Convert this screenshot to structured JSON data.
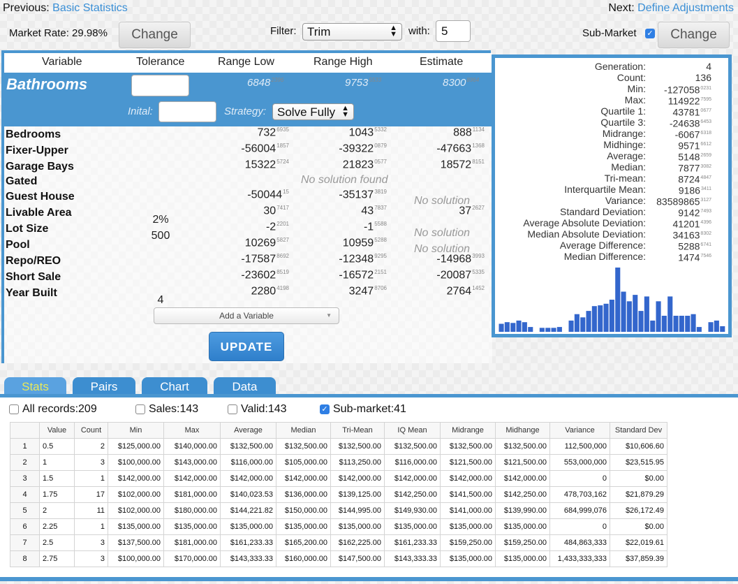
{
  "nav": {
    "previous_label": "Previous:",
    "previous_link": "Basic Statistics",
    "next_label": "Next:",
    "next_link": "Define Adjustments"
  },
  "toolbar": {
    "market_rate": "Market Rate: 29.98%",
    "change_label": "Change",
    "filter_label": "Filter:",
    "filter_value": "Trim",
    "with_label": "with:",
    "with_value": "5",
    "submarket_label": "Sub-Market",
    "submarket_checked": true,
    "change2_label": "Change"
  },
  "columns": {
    "variable": "Variable",
    "tolerance": "Tolerance",
    "range_low": "Range Low",
    "range_high": "Range High",
    "estimate": "Estimate"
  },
  "selected": {
    "name": "Bathrooms",
    "range_low": "6848",
    "range_low_sup": "2396",
    "range_high": "9753",
    "range_high_sup": "5533",
    "estimate": "8300",
    "estimate_sup": "8964",
    "initial_label": "Inital:",
    "strategy_label": "Strategy:",
    "strategy_value": "Solve Fully"
  },
  "variables": [
    {
      "name": "Bedrooms",
      "tol": "",
      "low": "732",
      "low_sup": "6935",
      "high": "1043",
      "high_sup": "5332",
      "est": "888",
      "est_sup": "1134",
      "note": ""
    },
    {
      "name": "Fixer-Upper",
      "tol": "",
      "low": "-56004",
      "low_sup": "1857",
      "high": "-39322",
      "high_sup": "0879",
      "est": "-47663",
      "est_sup": "1368",
      "note": ""
    },
    {
      "name": "Garage Bays",
      "tol": "",
      "low": "15322",
      "low_sup": "5724",
      "high": "21823",
      "high_sup": "0577",
      "est": "18572",
      "est_sup": "8151",
      "note": ""
    },
    {
      "name": "Gated",
      "tol": "",
      "low": "",
      "low_sup": "",
      "high": "",
      "high_sup": "",
      "est": "",
      "est_sup": "",
      "note": "No solution found"
    },
    {
      "name": "Guest House",
      "tol": "",
      "low": "-50044",
      "low_sup": "15",
      "high": "-35137",
      "high_sup": "3819",
      "est": "",
      "est_sup": "",
      "note": "No solution"
    },
    {
      "name": "Livable Area",
      "tol": "2%",
      "low": "30",
      "low_sup": "7417",
      "high": "43",
      "high_sup": "7837",
      "est": "37",
      "est_sup": "2627",
      "note": ""
    },
    {
      "name": "Lot Size",
      "tol": "500",
      "low": "-2",
      "low_sup": "2201",
      "high": "-1",
      "high_sup": "5588",
      "est": "",
      "est_sup": "",
      "note": "No solution"
    },
    {
      "name": "Pool",
      "tol": "",
      "low": "10269",
      "low_sup": "5827",
      "high": "10959",
      "high_sup": "5288",
      "est": "",
      "est_sup": "",
      "note": "No solution"
    },
    {
      "name": "Repo/REO",
      "tol": "",
      "low": "-17587",
      "low_sup": "8692",
      "high": "-12348",
      "high_sup": "9295",
      "est": "-14968",
      "est_sup": "3993",
      "note": ""
    },
    {
      "name": "Short Sale",
      "tol": "",
      "low": "-23602",
      "low_sup": "8519",
      "high": "-16572",
      "high_sup": "2151",
      "est": "-20087",
      "est_sup": "5335",
      "note": ""
    },
    {
      "name": "Year Built",
      "tol": "4",
      "low": "2280",
      "low_sup": "4198",
      "high": "3247",
      "high_sup": "8706",
      "est": "2764",
      "est_sup": "1452",
      "note": ""
    }
  ],
  "add_variable": "Add a Variable",
  "update_label": "UPDATE",
  "stats": [
    {
      "label": "Generation:",
      "value": "4",
      "sup": ""
    },
    {
      "label": "Count:",
      "value": "136",
      "sup": ""
    },
    {
      "label": "Min:",
      "value": "-127058",
      "sup": "0231"
    },
    {
      "label": "Max:",
      "value": "114922",
      "sup": "7595"
    },
    {
      "label": "Quartile 1:",
      "value": "43781",
      "sup": "0677"
    },
    {
      "label": "Quartile 3:",
      "value": "-24638",
      "sup": "6453"
    },
    {
      "label": "Midrange:",
      "value": "-6067",
      "sup": "6318"
    },
    {
      "label": "Midhinge:",
      "value": "9571",
      "sup": "6612"
    },
    {
      "label": "Average:",
      "value": "5148",
      "sup": "2659"
    },
    {
      "label": "Median:",
      "value": "7877",
      "sup": "3082"
    },
    {
      "label": "Tri-mean:",
      "value": "8724",
      "sup": "4847"
    },
    {
      "label": "Interquartile Mean:",
      "value": "9186",
      "sup": "3411"
    },
    {
      "label": "Variance:",
      "value": "83589865",
      "sup": "3127"
    },
    {
      "label": "Standard Deviation:",
      "value": "9142",
      "sup": "7493"
    },
    {
      "label": "Average Absolute Deviation:",
      "value": "41201",
      "sup": "4396"
    },
    {
      "label": "Median Absolute Deviation:",
      "value": "34163",
      "sup": "8302"
    },
    {
      "label": "Average Difference:",
      "value": "5288",
      "sup": "6741"
    },
    {
      "label": "Median Difference:",
      "value": "1474",
      "sup": "7546"
    }
  ],
  "chart_data": {
    "type": "bar",
    "values": [
      10,
      12,
      11,
      14,
      12,
      6,
      0,
      5,
      5,
      5,
      6,
      0,
      14,
      22,
      18,
      26,
      32,
      33,
      35,
      40,
      80,
      50,
      38,
      46,
      26,
      44,
      14,
      38,
      20,
      44,
      20,
      20,
      20,
      22,
      6,
      0,
      12,
      14,
      7
    ],
    "color": "#3366cc"
  },
  "tabs": [
    "Stats",
    "Pairs",
    "Chart",
    "Data"
  ],
  "filters": [
    {
      "label": "All records:209",
      "checked": false
    },
    {
      "label": "Sales:143",
      "checked": false
    },
    {
      "label": "Valid:143",
      "checked": false
    },
    {
      "label": "Sub-market:41",
      "checked": true
    }
  ],
  "table": {
    "headers": [
      "",
      "Value",
      "Count",
      "Min",
      "Max",
      "Average",
      "Median",
      "Tri-Mean",
      "IQ Mean",
      "Midrange",
      "Midhange",
      "Variance",
      "Standard Dev"
    ],
    "rows": [
      [
        "1",
        "0.5",
        "2",
        "$125,000.00",
        "$140,000.00",
        "$132,500.00",
        "$132,500.00",
        "$132,500.00",
        "$132,500.00",
        "$132,500.00",
        "$132,500.00",
        "112,500,000",
        "$10,606.60"
      ],
      [
        "2",
        "1",
        "3",
        "$100,000.00",
        "$143,000.00",
        "$116,000.00",
        "$105,000.00",
        "$113,250.00",
        "$116,000.00",
        "$121,500.00",
        "$121,500.00",
        "553,000,000",
        "$23,515.95"
      ],
      [
        "3",
        "1.5",
        "1",
        "$142,000.00",
        "$142,000.00",
        "$142,000.00",
        "$142,000.00",
        "$142,000.00",
        "$142,000.00",
        "$142,000.00",
        "$142,000.00",
        "0",
        "$0.00"
      ],
      [
        "4",
        "1.75",
        "17",
        "$102,000.00",
        "$181,000.00",
        "$140,023.53",
        "$136,000.00",
        "$139,125.00",
        "$142,250.00",
        "$141,500.00",
        "$142,250.00",
        "478,703,162",
        "$21,879.29"
      ],
      [
        "5",
        "2",
        "11",
        "$102,000.00",
        "$180,000.00",
        "$144,221.82",
        "$150,000.00",
        "$144,995.00",
        "$149,930.00",
        "$141,000.00",
        "$139,990.00",
        "684,999,076",
        "$26,172.49"
      ],
      [
        "6",
        "2.25",
        "1",
        "$135,000.00",
        "$135,000.00",
        "$135,000.00",
        "$135,000.00",
        "$135,000.00",
        "$135,000.00",
        "$135,000.00",
        "$135,000.00",
        "0",
        "$0.00"
      ],
      [
        "7",
        "2.5",
        "3",
        "$137,500.00",
        "$181,000.00",
        "$161,233.33",
        "$165,200.00",
        "$162,225.00",
        "$161,233.33",
        "$159,250.00",
        "$159,250.00",
        "484,863,333",
        "$22,019.61"
      ],
      [
        "8",
        "2.75",
        "3",
        "$100,000.00",
        "$170,000.00",
        "$143,333.33",
        "$160,000.00",
        "$147,500.00",
        "$143,333.33",
        "$135,000.00",
        "$135,000.00",
        "1,433,333,333",
        "$37,859.39"
      ]
    ]
  }
}
